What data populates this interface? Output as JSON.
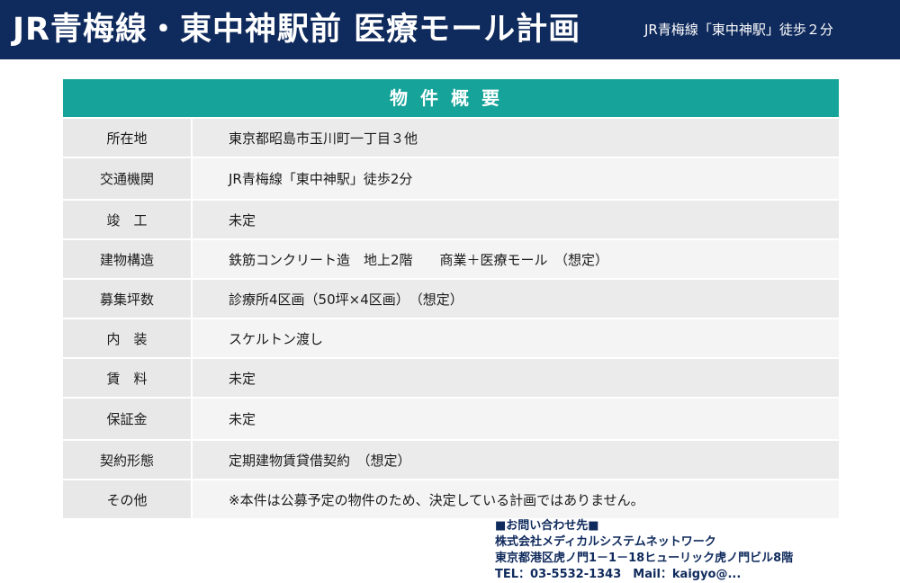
{
  "header": {
    "title": "JR青梅線・東中神駅前 医療モール計画",
    "subtitle": "JR青梅線「東中神駅」徒歩２分"
  },
  "table": {
    "title": "物件概要",
    "rows": [
      {
        "label": "所在地",
        "value": "東京都昭島市玉川町一丁目３他"
      },
      {
        "label": "交通機関",
        "value": "JR青梅線「東中神駅」徒歩2分"
      },
      {
        "label": "竣　工",
        "value": "未定"
      },
      {
        "label": "建物構造",
        "value": "鉄筋コンクリート造　地上2階　　商業＋医療モール　（想定）"
      },
      {
        "label": "募集坪数",
        "value": "診療所4区画（50坪×4区画）　（想定）"
      },
      {
        "label": "内　装",
        "value": "スケルトン渡し"
      },
      {
        "label": "賃　料",
        "value": "未定"
      },
      {
        "label": "保証金",
        "value": "未定"
      },
      {
        "label": "契約形態",
        "value": "定期建物賃貸借契約　（想定）"
      },
      {
        "label": "その他",
        "value": "※本件は公募予定の物件のため、決定している計画ではありません。"
      }
    ]
  },
  "contact": {
    "heading": "■お問い合わせ先■",
    "company": "株式会社メディカルシステムネットワーク",
    "address": "東京都港区虎ノ門1－1－18ヒューリック虎ノ門ビル8階",
    "tel": "TEL：03-5532-1343　Mail：kaigyo@..."
  },
  "colors": {
    "header_bg": "#0f2a5c",
    "table_title_bg": "#16a39a"
  }
}
